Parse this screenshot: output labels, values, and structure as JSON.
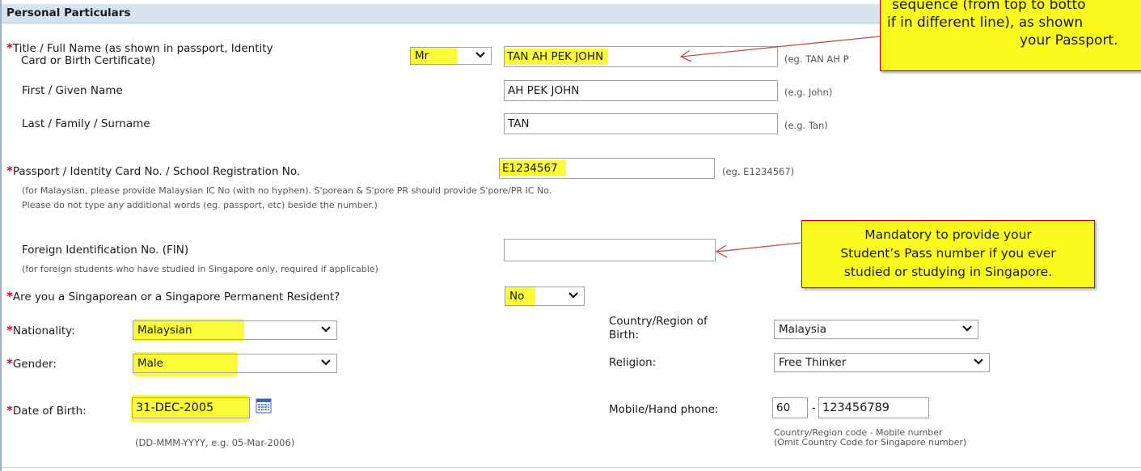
{
  "section": {
    "title": "Personal Particulars"
  },
  "fields": {
    "full_name": {
      "label_line1": "Title / Full Name (as shown in passport, Identity",
      "label_line2": "Card or Birth Certificate)",
      "title_value": "Mr",
      "value": "TAN AH PEK JOHN",
      "hint": "(eg. TAN AH P"
    },
    "first_name": {
      "label": "First / Given Name",
      "value": "AH PEK JOHN",
      "hint": "(e.g. John)"
    },
    "last_name": {
      "label": "Last / Family / Surname",
      "value": "TAN",
      "hint": "(e.g. Tan)"
    },
    "passport": {
      "label": "Passport / Identity Card No. / School Registration No.",
      "value": "E1234567",
      "hint": "(eg. E1234567)",
      "note_line1": "(for Malaysian, please provide Malaysian IC No (with no hyphen). S'porean & S'pore PR should provide S'pore/PR IC No.",
      "note_line2": "Please do not type any additional words  (eg. passport, etc)  beside the number.)"
    },
    "fin": {
      "label": "Foreign Identification No. (FIN)",
      "value": "",
      "note": "(for foreign students who have studied in Singapore only, required if applicable)"
    },
    "sg_resident": {
      "label": "Are you a Singaporean or a Singapore Permanent Resident?",
      "value": "No"
    },
    "nationality": {
      "label": "Nationality:",
      "value": "Malaysian"
    },
    "gender": {
      "label": "Gender:",
      "value": "Male"
    },
    "dob": {
      "label": "Date of Birth:",
      "value": "31-DEC-2005",
      "hint": "(DD-MMM-YYYY, e.g. 05-Mar-2006)"
    },
    "country_birth": {
      "label_line1": "Country/Region of",
      "label_line2": "Birth:",
      "value": "Malaysia"
    },
    "religion": {
      "label": "Religion:",
      "value": "Free Thinker"
    },
    "mobile": {
      "label": "Mobile/Hand phone:",
      "country_code": "60",
      "separator": "-",
      "number": "123456789",
      "hint_line1": "Country/Region code - Mobile number",
      "hint_line2": "(Omit Country Code for Singapore number)"
    }
  },
  "callouts": {
    "top": {
      "line1": "sequence (from top to botto",
      "line2": "if in different line), as shown",
      "line3": "your Passport."
    },
    "fin": {
      "line1": "Mandatory to provide your",
      "line2": "Student’s Pass number if you ever",
      "line3": "studied or studying in Singapore."
    }
  },
  "required_mark": "*",
  "icons": {
    "dropdown": "chevron-down-icon",
    "calendar": "calendar-icon"
  },
  "colors": {
    "highlight": "#fbfb3a",
    "required": "#e0002a",
    "header_bg": "#d6e4f1",
    "callout_border": "#c00000"
  }
}
